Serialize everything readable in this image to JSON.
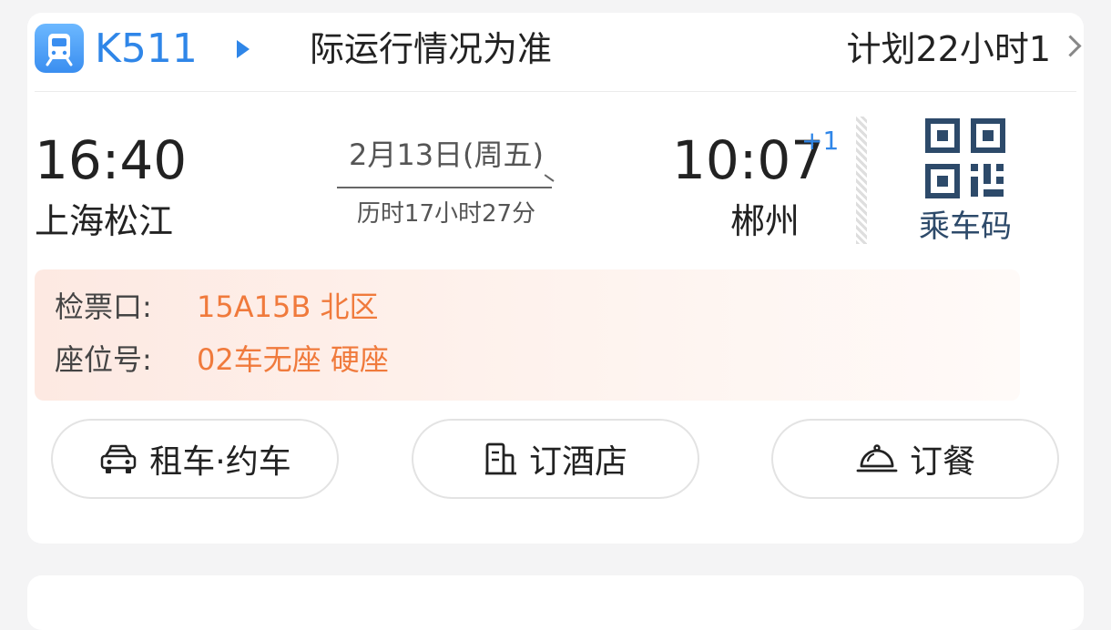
{
  "header": {
    "train_icon": "train-icon",
    "train_no": "K511",
    "notice": "际运行情况为准",
    "plan_text": "计划22小时1"
  },
  "journey": {
    "departure_time": "16:40",
    "departure_station": "上海松江",
    "date": "2月13日(周五)",
    "duration": "历时17小时27分",
    "arrival_time": "10:07",
    "arrival_day_offset": "+1",
    "arrival_station": "郴州"
  },
  "boarding_code": {
    "icon": "qr-code-icon",
    "label": "乘车码"
  },
  "info": {
    "gate_label": "检票口:",
    "gate_value": "15A15B 北区",
    "seat_label": "座位号:",
    "seat_value": "02车无座 硬座"
  },
  "actions": [
    {
      "label": "租车·约车",
      "icon": "car-icon"
    },
    {
      "label": "订酒店",
      "icon": "hotel-icon"
    },
    {
      "label": "订餐",
      "icon": "food-cloche-icon"
    }
  ],
  "colors": {
    "accent": "#2f86e8",
    "orange": "#f07a3c",
    "qr": "#2d4a6a"
  }
}
